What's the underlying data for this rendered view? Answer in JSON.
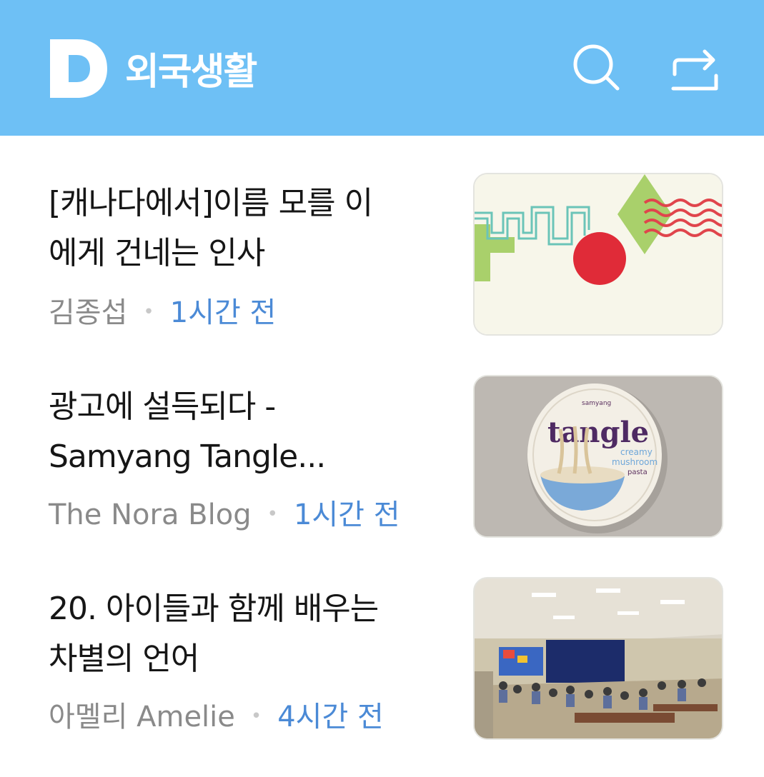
{
  "header": {
    "logo_letter": "D",
    "title": "외국생활",
    "search_icon": "search-icon",
    "share_icon": "share-icon",
    "background": "#6ec0f5"
  },
  "articles": [
    {
      "title_line1": "[캐나다에서]이름 모를 이",
      "title_line2": "에게 건네는 인사",
      "author": "김종섭",
      "separator": "•",
      "time": "1시간 전",
      "thumbnail": "abstract-pattern-image"
    },
    {
      "title_line1": "광고에 설득되다 -",
      "title_line2": "Samyang Tangle...",
      "author": "The Nora Blog",
      "separator": "•",
      "time": "1시간 전",
      "thumbnail": "tangle-noodle-cup-image",
      "thumbnail_text": {
        "brand": "samyang",
        "product": "tangle",
        "flavor_line1": "creamy",
        "flavor_line2": "mushroom",
        "flavor_line3": "pasta"
      }
    },
    {
      "title_line1": "20. 아이들과 함께 배우는",
      "title_line2": "차별의 언어",
      "author": "아멜리 Amelie",
      "separator": "•",
      "time": "4시간 전",
      "thumbnail": "school-gym-assembly-image"
    }
  ],
  "colors": {
    "header_bg": "#6ec0f5",
    "title_text": "#161616",
    "author_text": "#8a8a8a",
    "time_text": "#4b8ad6"
  }
}
